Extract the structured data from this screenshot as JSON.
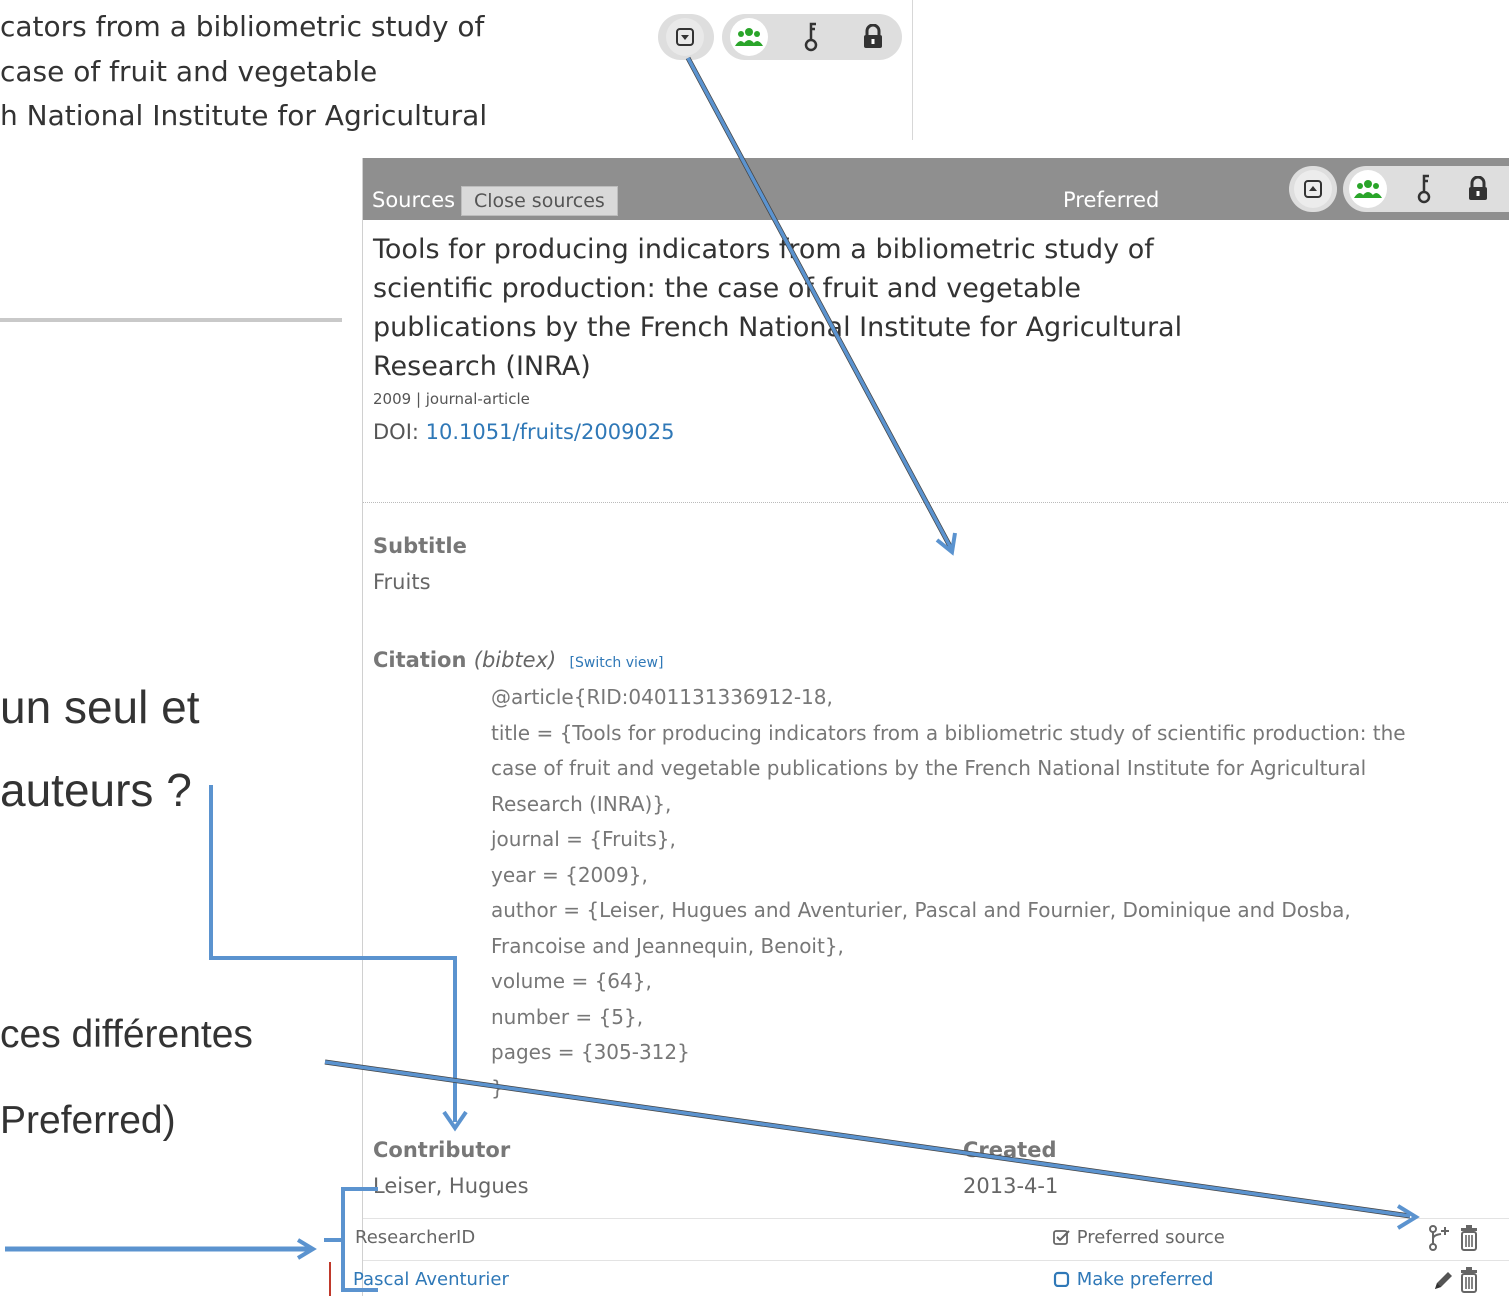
{
  "top_card": {
    "title_lines": [
      "cators from a bibliometric study of",
      " case of fruit and vegetable",
      "h National Institute for Agricultural"
    ]
  },
  "slide": {
    "lines": [
      "un seul et",
      "auteurs ?",
      "ces différentes",
      "Preferred)"
    ]
  },
  "sources_panel": {
    "header": {
      "sources_label": "Sources",
      "close_button": "Close sources",
      "preferred_label": "Preferred"
    },
    "toolbar_icons": [
      "expand-icon",
      "people-icon",
      "key-icon",
      "lock-icon"
    ],
    "work": {
      "title": "Tools for producing indicators from a bibliometric study of scientific production: the case of fruit and vegetable publications by the French National Institute for Agricultural Research (INRA)",
      "meta": "2009 | journal-article",
      "doi_label": "DOI: ",
      "doi": "10.1051/fruits/2009025"
    },
    "subtitle": {
      "label": "Subtitle",
      "value": "Fruits"
    },
    "citation": {
      "label": "Citation",
      "format": "(bibtex)",
      "switch_view": "[Switch view]",
      "lines": [
        "@article{RID:0401131336912-18,",
        "title = {Tools for producing indicators from a bibliometric study of scientific production: the",
        "case of fruit and vegetable publications by the French National Institute for Agricultural",
        "Research (INRA)},",
        "journal = {Fruits},",
        "year = {2009},",
        "author = {Leiser, Hugues and  Aventurier, Pascal and  Fournier, Dominique and  Dosba,",
        "Francoise and  Jeannequin, Benoit},",
        "volume = {64},",
        "number = {5},",
        "pages = {305-312}",
        "}"
      ]
    },
    "contributor": {
      "label": "Contributor",
      "value": "Leiser, Hugues"
    },
    "created": {
      "label": "Created",
      "value": "2013-4-1"
    },
    "sources": [
      {
        "name": "ResearcherID",
        "status": "Preferred source",
        "icons": [
          "branch-add-icon",
          "trash-icon"
        ]
      },
      {
        "name": "Pascal Aventurier",
        "status": "Make preferred",
        "icons": [
          "pencil-icon",
          "trash-icon"
        ]
      }
    ]
  },
  "colors": {
    "header_bg": "#8f8f8f",
    "link": "#2f78b7",
    "people_icon": "#2aa52a",
    "arrow": "#5b93cf"
  }
}
